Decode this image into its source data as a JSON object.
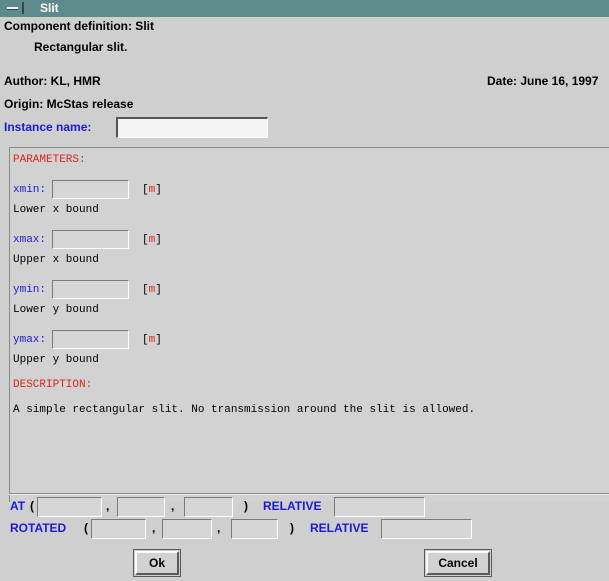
{
  "window": {
    "title": "Slit"
  },
  "header": {
    "component_definition": "Component definition: Slit",
    "short_description": "Rectangular slit.",
    "author": "Author:  KL, HMR",
    "date": "Date:  June 16, 1997",
    "origin": "Origin:  McStas release",
    "instance_label": "Instance name:",
    "instance_value": ""
  },
  "parameters": {
    "heading": "PARAMETERS:",
    "items": [
      {
        "name": "xmin:",
        "unit": "m",
        "desc": "Lower x bound",
        "value": ""
      },
      {
        "name": "xmax:",
        "unit": "m",
        "desc": "Upper x bound",
        "value": ""
      },
      {
        "name": "ymin:",
        "unit": "m",
        "desc": "Lower y bound",
        "value": ""
      },
      {
        "name": "ymax:",
        "unit": "m",
        "desc": "Upper y bound",
        "value": ""
      }
    ]
  },
  "description": {
    "heading": "DESCRIPTION:",
    "text": "A simple rectangular slit. No transmission around the slit is allowed."
  },
  "placement": {
    "at_label": "AT",
    "rotated_label": "ROTATED",
    "relative_label": "RELATIVE",
    "open_paren": "(",
    "close_paren": ")",
    "comma": ","
  },
  "buttons": {
    "ok": "Ok",
    "cancel": "Cancel"
  },
  "colors": {
    "titlebar": "#5f8a8b",
    "label_blue": "#1b1bd6",
    "heading_red": "#d8261d",
    "background": "#cfcfcf"
  }
}
